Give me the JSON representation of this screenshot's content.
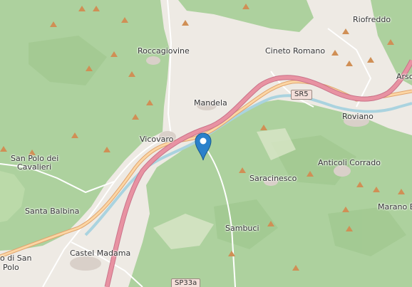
{
  "map": {
    "places": {
      "riofreddo": "Riofreddo",
      "roccagiovine": "Roccagiovine",
      "cineto_romano": "Cineto Romano",
      "mandela": "Mandela",
      "roviano": "Roviano",
      "arsoli": "Arso",
      "vicovaro": "Vicovaro",
      "san_polo_1": "San Polo dei",
      "san_polo_2": "Cavalieri",
      "anticoli": "Anticoli Corrado",
      "saracinesco": "Saracinesco",
      "santa_balbina": "Santa Balbina",
      "marano": "Marano Eq",
      "sambuci": "Sambuci",
      "castel_madama": "Castel Madama",
      "castello_1": "o di San",
      "castello_2": "Polo"
    },
    "roads": {
      "sr5": "SR5",
      "sp33a": "SP33a"
    },
    "marker": "map-pin-icon",
    "colors": {
      "land": "#eeeae4",
      "forest": "#add19e",
      "forest_dark": "#a2c896",
      "river": "#aad3df",
      "motorway": "#e892a2",
      "primary": "#fcd6a4",
      "pin": "#2a81cb",
      "peak": "#d08f55"
    }
  }
}
